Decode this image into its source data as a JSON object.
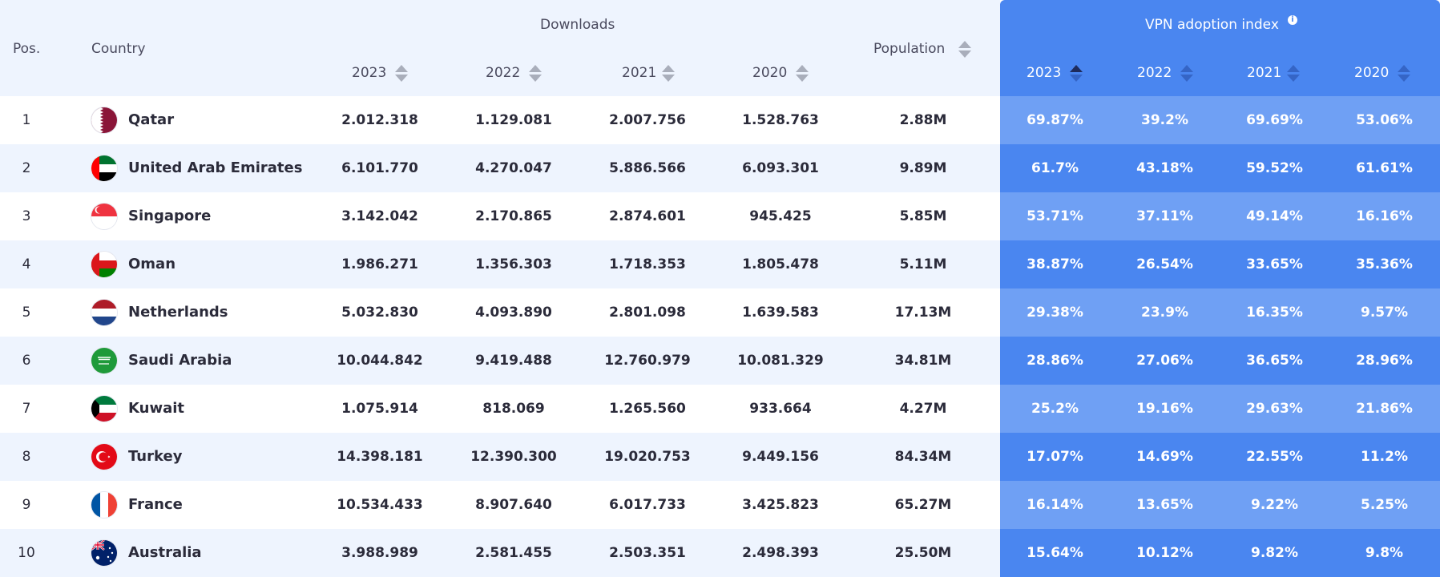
{
  "header": {
    "pos_label": "Pos.",
    "country_label": "Country",
    "downloads_label": "Downloads",
    "population_label": "Population",
    "vpn_label": "VPN adoption index",
    "download_years": [
      "2023",
      "2022",
      "2021",
      "2020"
    ],
    "vpn_years": [
      "2023",
      "2022",
      "2021",
      "2020"
    ]
  },
  "rows": [
    {
      "pos": "1",
      "country": "Qatar",
      "flag": "qatar-flag-icon",
      "d2023": "2.012.318",
      "d2022": "1.129.081",
      "d2021": "2.007.756",
      "d2020": "1.528.763",
      "population": "2.88M",
      "v2023": "69.87%",
      "v2022": "39.2%",
      "v2021": "69.69%",
      "v2020": "53.06%"
    },
    {
      "pos": "2",
      "country": "United Arab Emirates",
      "flag": "uae-flag-icon",
      "d2023": "6.101.770",
      "d2022": "4.270.047",
      "d2021": "5.886.566",
      "d2020": "6.093.301",
      "population": "9.89M",
      "v2023": "61.7%",
      "v2022": "43.18%",
      "v2021": "59.52%",
      "v2020": "61.61%"
    },
    {
      "pos": "3",
      "country": "Singapore",
      "flag": "singapore-flag-icon",
      "d2023": "3.142.042",
      "d2022": "2.170.865",
      "d2021": "2.874.601",
      "d2020": "945.425",
      "population": "5.85M",
      "v2023": "53.71%",
      "v2022": "37.11%",
      "v2021": "49.14%",
      "v2020": "16.16%"
    },
    {
      "pos": "4",
      "country": "Oman",
      "flag": "oman-flag-icon",
      "d2023": "1.986.271",
      "d2022": "1.356.303",
      "d2021": "1.718.353",
      "d2020": "1.805.478",
      "population": "5.11M",
      "v2023": "38.87%",
      "v2022": "26.54%",
      "v2021": "33.65%",
      "v2020": "35.36%"
    },
    {
      "pos": "5",
      "country": "Netherlands",
      "flag": "netherlands-flag-icon",
      "d2023": "5.032.830",
      "d2022": "4.093.890",
      "d2021": "2.801.098",
      "d2020": "1.639.583",
      "population": "17.13M",
      "v2023": "29.38%",
      "v2022": "23.9%",
      "v2021": "16.35%",
      "v2020": "9.57%"
    },
    {
      "pos": "6",
      "country": "Saudi Arabia",
      "flag": "saudi-arabia-flag-icon",
      "d2023": "10.044.842",
      "d2022": "9.419.488",
      "d2021": "12.760.979",
      "d2020": "10.081.329",
      "population": "34.81M",
      "v2023": "28.86%",
      "v2022": "27.06%",
      "v2021": "36.65%",
      "v2020": "28.96%"
    },
    {
      "pos": "7",
      "country": "Kuwait",
      "flag": "kuwait-flag-icon",
      "d2023": "1.075.914",
      "d2022": "818.069",
      "d2021": "1.265.560",
      "d2020": "933.664",
      "population": "4.27M",
      "v2023": "25.2%",
      "v2022": "19.16%",
      "v2021": "29.63%",
      "v2020": "21.86%"
    },
    {
      "pos": "8",
      "country": "Turkey",
      "flag": "turkey-flag-icon",
      "d2023": "14.398.181",
      "d2022": "12.390.300",
      "d2021": "19.020.753",
      "d2020": "9.449.156",
      "population": "84.34M",
      "v2023": "17.07%",
      "v2022": "14.69%",
      "v2021": "22.55%",
      "v2020": "11.2%"
    },
    {
      "pos": "9",
      "country": "France",
      "flag": "france-flag-icon",
      "d2023": "10.534.433",
      "d2022": "8.907.640",
      "d2021": "6.017.733",
      "d2020": "3.425.823",
      "population": "65.27M",
      "v2023": "16.14%",
      "v2022": "13.65%",
      "v2021": "9.22%",
      "v2020": "5.25%"
    },
    {
      "pos": "10",
      "country": "Australia",
      "flag": "australia-flag-icon",
      "d2023": "3.988.989",
      "d2022": "2.581.455",
      "d2021": "2.503.351",
      "d2020": "2.498.393",
      "population": "25.50M",
      "v2023": "15.64%",
      "v2022": "10.12%",
      "v2021": "9.82%",
      "v2020": "9.8%"
    }
  ],
  "colors": {
    "vpn_blue": "#4a86f0",
    "vpn_light": "#6fa0f4",
    "row_tint": "#eef4fe"
  }
}
